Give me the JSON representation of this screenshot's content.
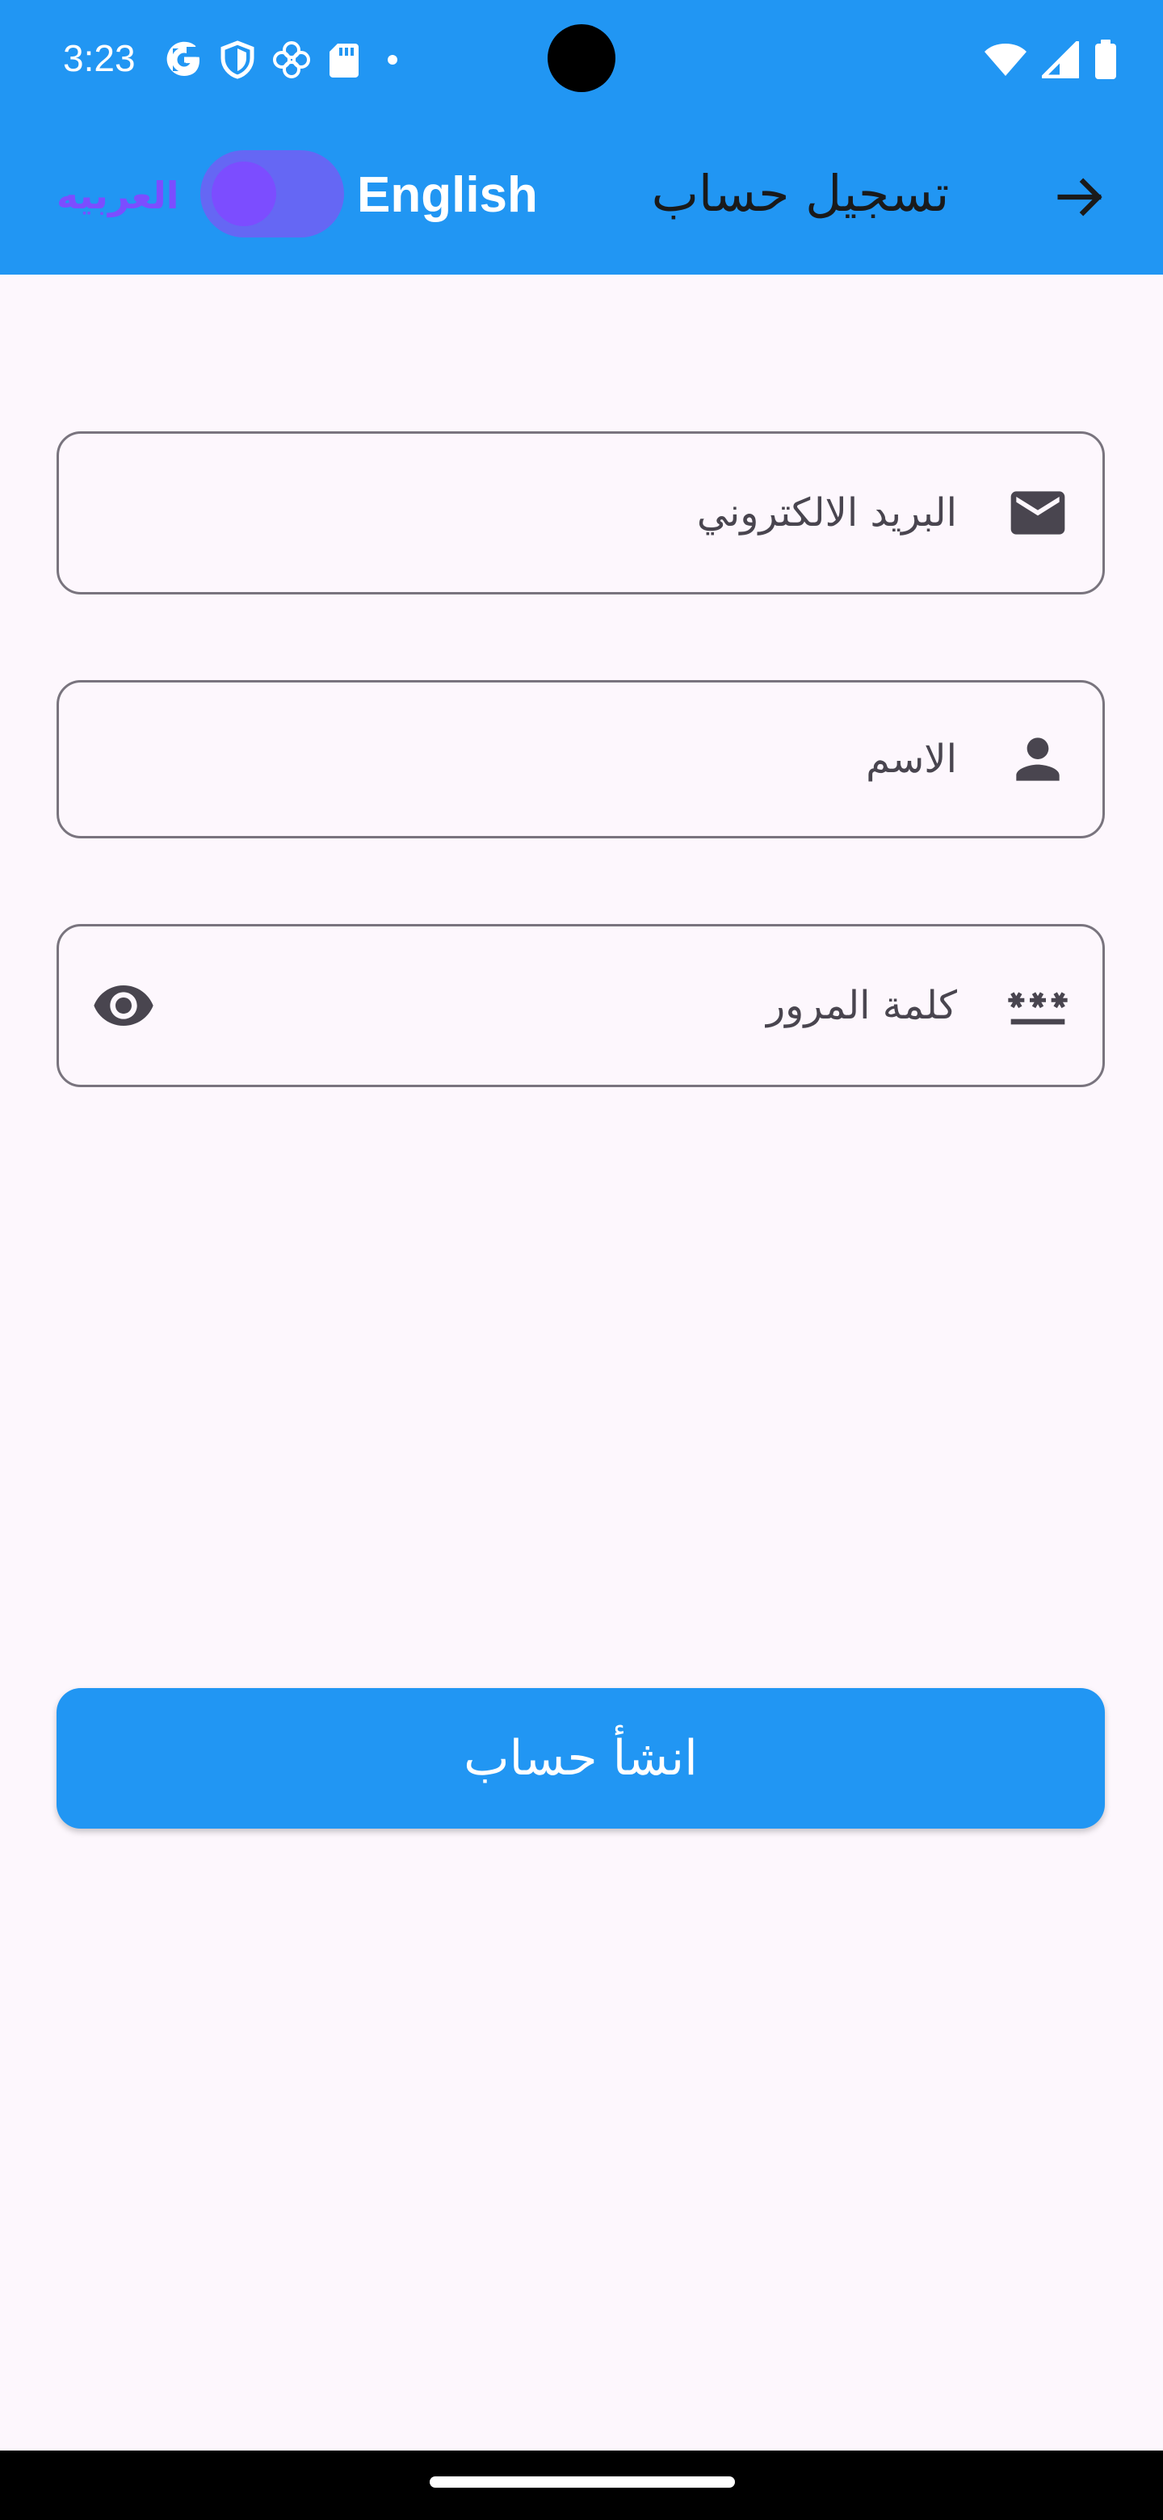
{
  "status_bar": {
    "time": "3:23",
    "left_icons": [
      "google-icon",
      "shield-icon",
      "pinwheel-icon",
      "sd-card-icon",
      "dot-icon"
    ],
    "right_icons": [
      "wifi-icon",
      "signal-icon",
      "battery-icon"
    ]
  },
  "app_bar": {
    "lang_arabic": "العربيه",
    "lang_english": "English",
    "title": "تسجيل حساب",
    "switch_on": true
  },
  "form": {
    "email": {
      "placeholder": "البريد الالكتروني",
      "value": ""
    },
    "name": {
      "placeholder": "الاسم",
      "value": ""
    },
    "password": {
      "placeholder": "كلمة المرور",
      "value": ""
    }
  },
  "submit": {
    "label": "انشأ حساب"
  },
  "colors": {
    "primary": "#2196f3",
    "accent": "#7c4dff",
    "background": "#fdf7fd",
    "outline": "#79747e",
    "icon": "#49454f"
  }
}
